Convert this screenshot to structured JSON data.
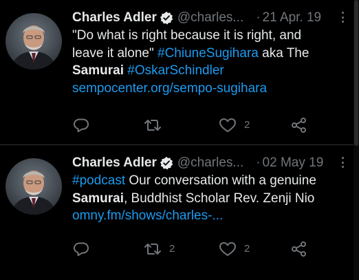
{
  "tweets": [
    {
      "author_name": "Charles Adler",
      "handle": "@charles...",
      "separator": "·",
      "date": "21 Apr. 19",
      "lines": [
        [
          {
            "t": "\"Do what is right because it is right, and",
            "s": "text"
          }
        ],
        [
          {
            "t": "leave it alone\" ",
            "s": "text"
          },
          {
            "t": "#ChiuneSugihara",
            "s": "link"
          },
          {
            "t": " aka The",
            "s": "text"
          }
        ],
        [
          {
            "t": "Samurai",
            "s": "bold"
          },
          {
            "t": " ",
            "s": "text"
          },
          {
            "t": "#OskarSchindler",
            "s": "link"
          }
        ],
        [
          {
            "t": "sempocenter.org/sempo-sugihara",
            "s": "link"
          }
        ]
      ],
      "reply_count": "",
      "retweet_count": "",
      "like_count": "2"
    },
    {
      "author_name": "Charles Adler",
      "handle": "@charles...",
      "separator": "·",
      "date": "02 May 19",
      "lines": [
        [
          {
            "t": "#podcast",
            "s": "link"
          },
          {
            "t": " Our conversation with a genuine",
            "s": "text"
          }
        ],
        [
          {
            "t": "Samurai",
            "s": "bold"
          },
          {
            "t": ", Buddhist Scholar Rev. Zenji Nio",
            "s": "text"
          }
        ],
        [
          {
            "t": "omny.fm/shows/charles-...",
            "s": "link"
          }
        ]
      ],
      "reply_count": "",
      "retweet_count": "2",
      "like_count": "2"
    }
  ],
  "icons": {
    "verified": "verified-badge-icon",
    "more": "more-options-icon",
    "reply": "reply-icon",
    "retweet": "retweet-icon",
    "like": "heart-icon",
    "share": "share-icon"
  },
  "colors": {
    "background": "#000000",
    "text": "#e7e9ea",
    "muted": "#71767b",
    "link": "#1d9bf0",
    "divider": "#2f3336"
  }
}
